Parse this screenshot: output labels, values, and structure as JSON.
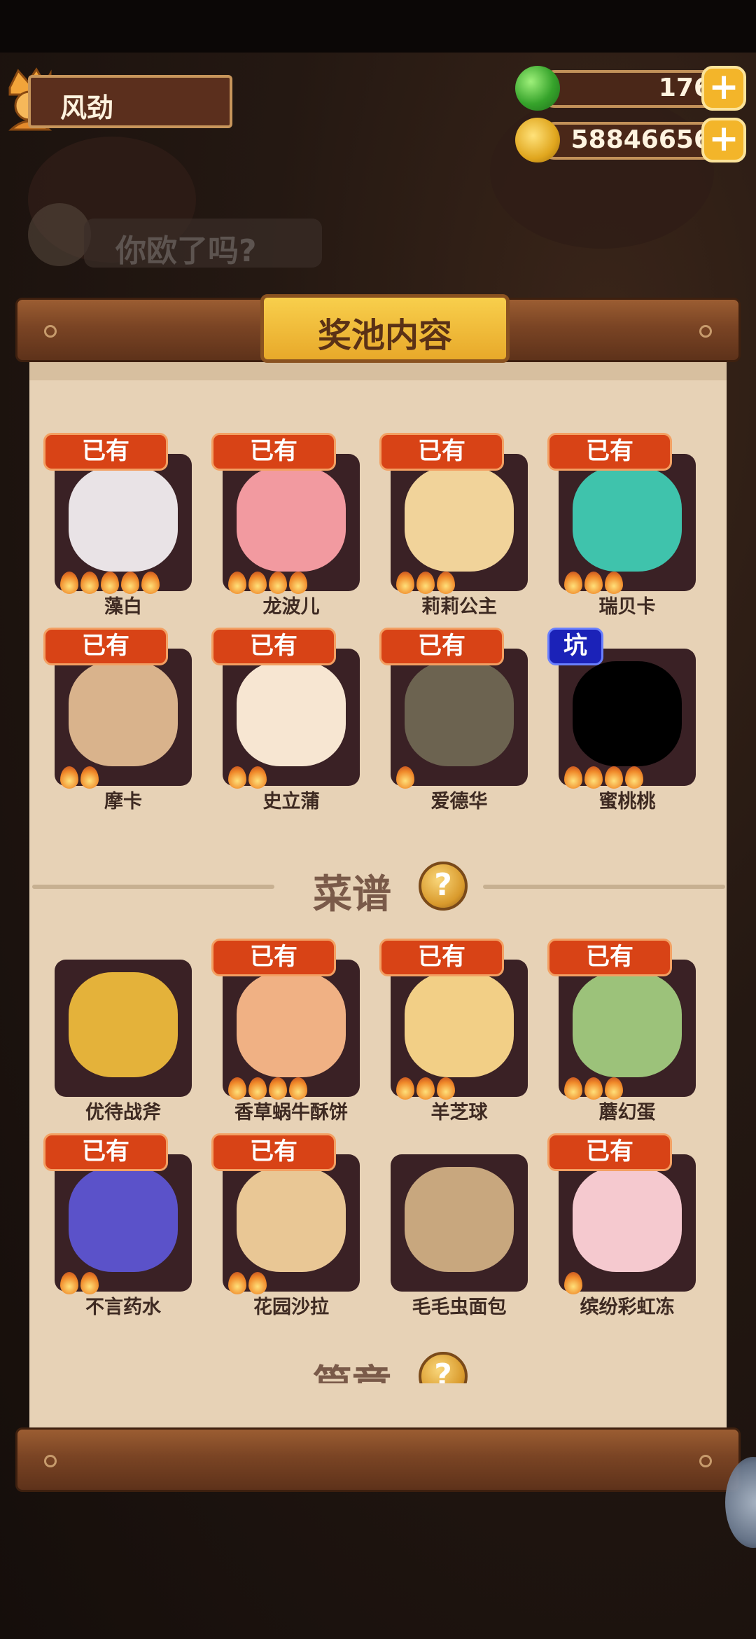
{
  "player": {
    "name": "风劲"
  },
  "currency": {
    "jade": {
      "value": "176",
      "icon": "jade-gem-icon"
    },
    "gold": {
      "value": "58846656",
      "icon": "gold-coin-icon"
    }
  },
  "background": {
    "chat_text": "你欧了吗?"
  },
  "panel": {
    "title": "奖池内容"
  },
  "characters": [
    {
      "name": "藻白",
      "tag": "已有",
      "tag_type": "owned",
      "stars": 5,
      "art": "#e9e3e6"
    },
    {
      "name": "龙波儿",
      "tag": "已有",
      "tag_type": "owned",
      "stars": 4,
      "art": "#f29aa0"
    },
    {
      "name": "莉莉公主",
      "tag": "已有",
      "tag_type": "owned",
      "stars": 3,
      "art": "#f1d39a"
    },
    {
      "name": "瑞贝卡",
      "tag": "已有",
      "tag_type": "owned",
      "stars": 3,
      "art": "#3fc3ac"
    },
    {
      "name": "摩卡",
      "tag": "已有",
      "tag_type": "owned",
      "stars": 2,
      "art": "#d9b38c"
    },
    {
      "name": "史立蒲",
      "tag": "已有",
      "tag_type": "owned",
      "stars": 2,
      "art": "#f7e6d2"
    },
    {
      "name": "爱德华",
      "tag": "已有",
      "tag_type": "owned",
      "stars": 1,
      "art": "#6c6350"
    },
    {
      "name": "蜜桃桃",
      "tag": "坑",
      "tag_type": "missing",
      "stars": 4,
      "art": "#000000"
    }
  ],
  "recipe_section": {
    "label": "菜谱",
    "help": "?"
  },
  "recipes": [
    {
      "name": "优待战斧",
      "tag": "",
      "tag_type": "none",
      "stars": 0,
      "art": "#e4b23a"
    },
    {
      "name": "香草蜗牛酥饼",
      "tag": "已有",
      "tag_type": "owned",
      "stars": 4,
      "art": "#f0b184"
    },
    {
      "name": "羊芝球",
      "tag": "已有",
      "tag_type": "owned",
      "stars": 3,
      "art": "#f2cf86"
    },
    {
      "name": "蘑幻蛋",
      "tag": "已有",
      "tag_type": "owned",
      "stars": 3,
      "art": "#9cc27a"
    },
    {
      "name": "不言药水",
      "tag": "已有",
      "tag_type": "owned",
      "stars": 2,
      "art": "#5b52c9"
    },
    {
      "name": "花园沙拉",
      "tag": "已有",
      "tag_type": "owned",
      "stars": 2,
      "art": "#e9c795"
    },
    {
      "name": "毛毛虫面包",
      "tag": "",
      "tag_type": "none",
      "stars": 0,
      "art": "#c8a77e"
    },
    {
      "name": "缤纷彩虹冻",
      "tag": "已有",
      "tag_type": "owned",
      "stars": 1,
      "art": "#f5c9cf"
    }
  ],
  "next_section": {
    "label": "篇章",
    "help": "?"
  }
}
